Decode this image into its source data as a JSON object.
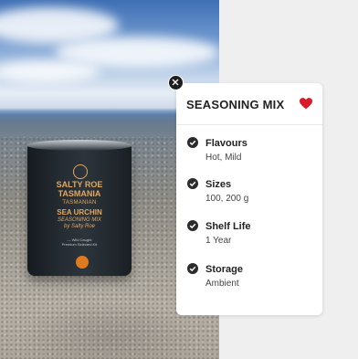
{
  "product_image": {
    "brand_line1": "SALTY ROE",
    "brand_line2": "TASMANIA",
    "sub_line": "TASMANIAN",
    "product_line": "SEA URCHIN",
    "script_line1": "SEASONING MIX",
    "script_line2": "by Salty Roe",
    "fine_print1": "— Wild Caught",
    "fine_print2": "Premium Selected Kit"
  },
  "card": {
    "title": "SEASONING MIX",
    "accent_color": "#d81b2a",
    "details": [
      {
        "label": "Flavours",
        "value": "Hot, Mild",
        "icon": "check-circle-icon"
      },
      {
        "label": "Sizes",
        "value": "100, 200 g",
        "icon": "check-circle-icon"
      },
      {
        "label": "Shelf Life",
        "value": "1 Year",
        "icon": "check-circle-icon"
      },
      {
        "label": "Storage",
        "value": "Ambient",
        "icon": "check-circle-icon"
      }
    ]
  }
}
